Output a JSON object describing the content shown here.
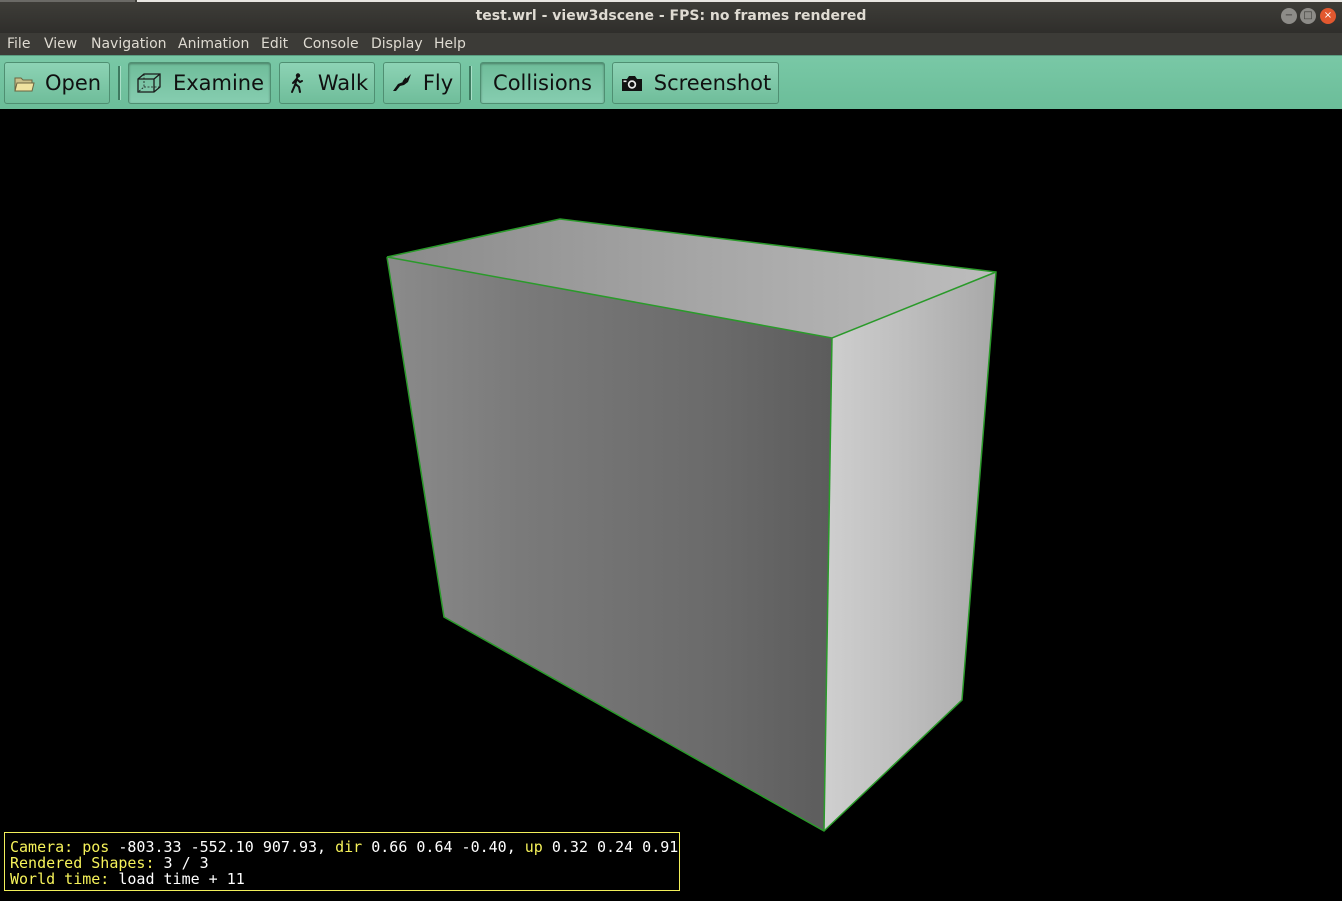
{
  "window": {
    "title": "test.wrl - view3dscene - FPS: no frames rendered",
    "min_glyph": "−",
    "max_glyph": "□",
    "close_glyph": "×"
  },
  "menu": [
    "File",
    "View",
    "Navigation",
    "Animation",
    "Edit",
    "Console",
    "Display",
    "Help"
  ],
  "toolbar": {
    "open": "Open",
    "examine": "Examine",
    "walk": "Walk",
    "fly": "Fly",
    "collisions": "Collisions",
    "screenshot": "Screenshot"
  },
  "status": {
    "camera_label": "Camera:",
    "pos_label": "pos",
    "pos_value": "-803.33 -552.10 907.93,",
    "dir_label": "dir",
    "dir_value": "0.66 0.64 -0.40,",
    "up_label": "up",
    "up_value": "0.32 0.24 0.91",
    "shapes_label": "Rendered Shapes:",
    "shapes_value": "3 / 3",
    "time_label": "World time:",
    "time_value": "load time + 11"
  },
  "colors": {
    "toolbar": "#72c19e",
    "edge": "#2a9a2a",
    "status_label": "#f6f25a"
  }
}
